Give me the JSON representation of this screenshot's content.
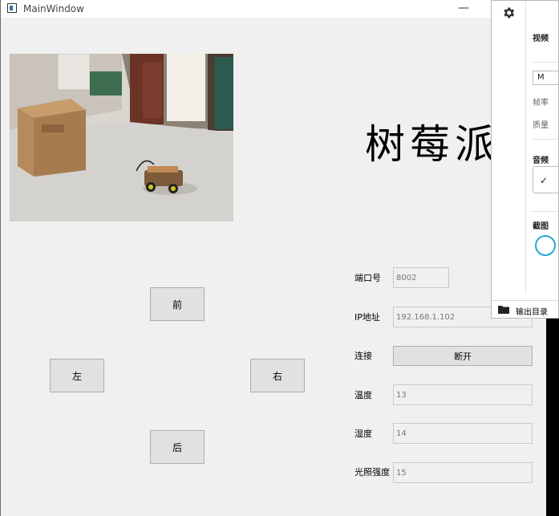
{
  "window": {
    "title": "MainWindow",
    "minimize_glyph": "—"
  },
  "controls": {
    "forward": "前",
    "left": "左",
    "right": "右",
    "back": "后"
  },
  "brand_text": "树莓派",
  "form": {
    "port_label": "端口号",
    "port_value": "8002",
    "ip_label": "IP地址",
    "ip_value": "192.168.1.102",
    "connect_label": "连接",
    "connect_button": "断开",
    "temp_label": "温度",
    "temp_value": "13",
    "humidity_label": "湿度",
    "humidity_value": "14",
    "light_label": "光照强度",
    "light_value": "15"
  },
  "overlay_panel": {
    "settings_icon": "gear-icon",
    "video_label": "视频",
    "format_value": "M",
    "framerate_label": "帧率",
    "quality_label": "质量",
    "audio_label": "音频",
    "screenshot_label": "截图",
    "output_label": "输出目录",
    "folder_icon": "folder-icon"
  }
}
